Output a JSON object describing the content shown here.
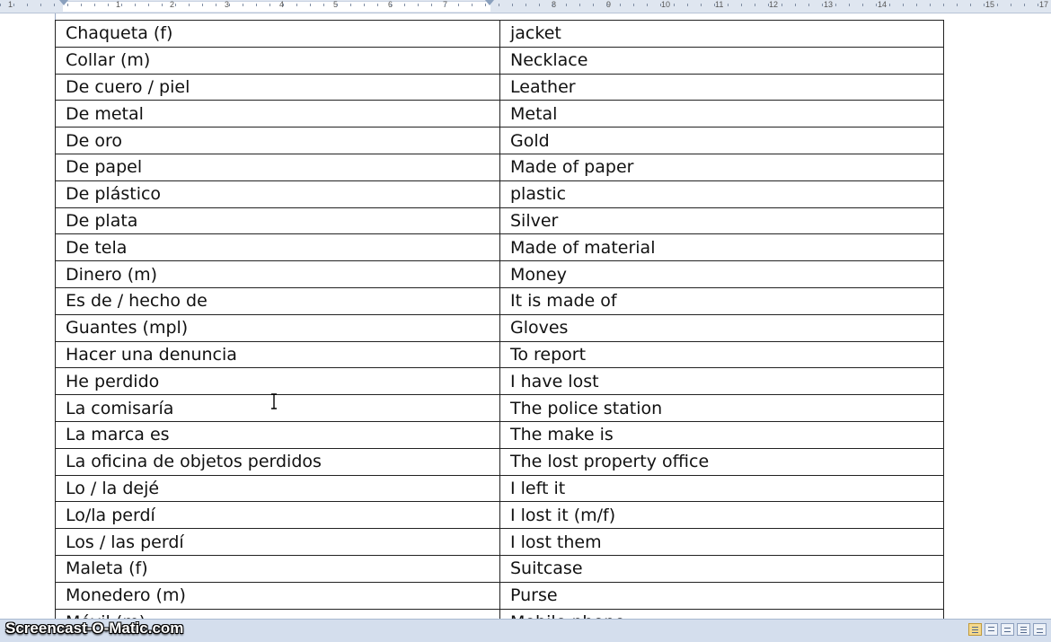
{
  "ruler": {
    "numbers": [
      "1",
      "1",
      "2",
      "3",
      "4",
      "5",
      "6",
      "7",
      "8",
      "9",
      "10",
      "11",
      "12",
      "13",
      "14",
      "15",
      "17",
      "18"
    ]
  },
  "table": {
    "rows": [
      {
        "es": "Chaqueta (f)",
        "en": "jacket"
      },
      {
        "es": "Collar (m)",
        "en": "Necklace"
      },
      {
        "es": "De cuero / piel",
        "en": "Leather"
      },
      {
        "es": "De metal",
        "en": "Metal"
      },
      {
        "es": "De oro",
        "en": "Gold"
      },
      {
        "es": "De papel",
        "en": "Made of paper"
      },
      {
        "es": "De plástico",
        "en": "plastic"
      },
      {
        "es": "De plata",
        "en": "Silver"
      },
      {
        "es": "De tela",
        "en": "Made of material"
      },
      {
        "es": "Dinero (m)",
        "en": "Money"
      },
      {
        "es": "Es de / hecho de",
        "en": "It is made of"
      },
      {
        "es": "Guantes (mpl)",
        "en": "Gloves"
      },
      {
        "es": "Hacer una denuncia",
        "en": "To report"
      },
      {
        "es": "He perdido",
        "en": "I have lost"
      },
      {
        "es": "La comisaría",
        "en": "The police station"
      },
      {
        "es": "La marca es",
        "en": "The make is"
      },
      {
        "es": "La oficina de objetos perdidos",
        "en": "The lost property office"
      },
      {
        "es": "Lo / la dejé",
        "en": "I left it"
      },
      {
        "es": "Lo/la perdí",
        "en": "I lost it (m/f)"
      },
      {
        "es": "Los / las perdí",
        "en": "I lost them"
      },
      {
        "es": "Maleta (f)",
        "en": "Suitcase"
      },
      {
        "es": "Monedero (m)",
        "en": "Purse"
      },
      {
        "es": "Móvil (m)",
        "en": "Mobile phone"
      }
    ]
  },
  "statusbar": {
    "watermark": "Screencast-O-Matic.com"
  },
  "icons": {
    "text_cursor": "i-beam-cursor-icon",
    "view_buttons": [
      "print-layout-icon",
      "full-screen-reading-icon",
      "web-layout-icon",
      "outline-icon",
      "draft-icon"
    ]
  }
}
